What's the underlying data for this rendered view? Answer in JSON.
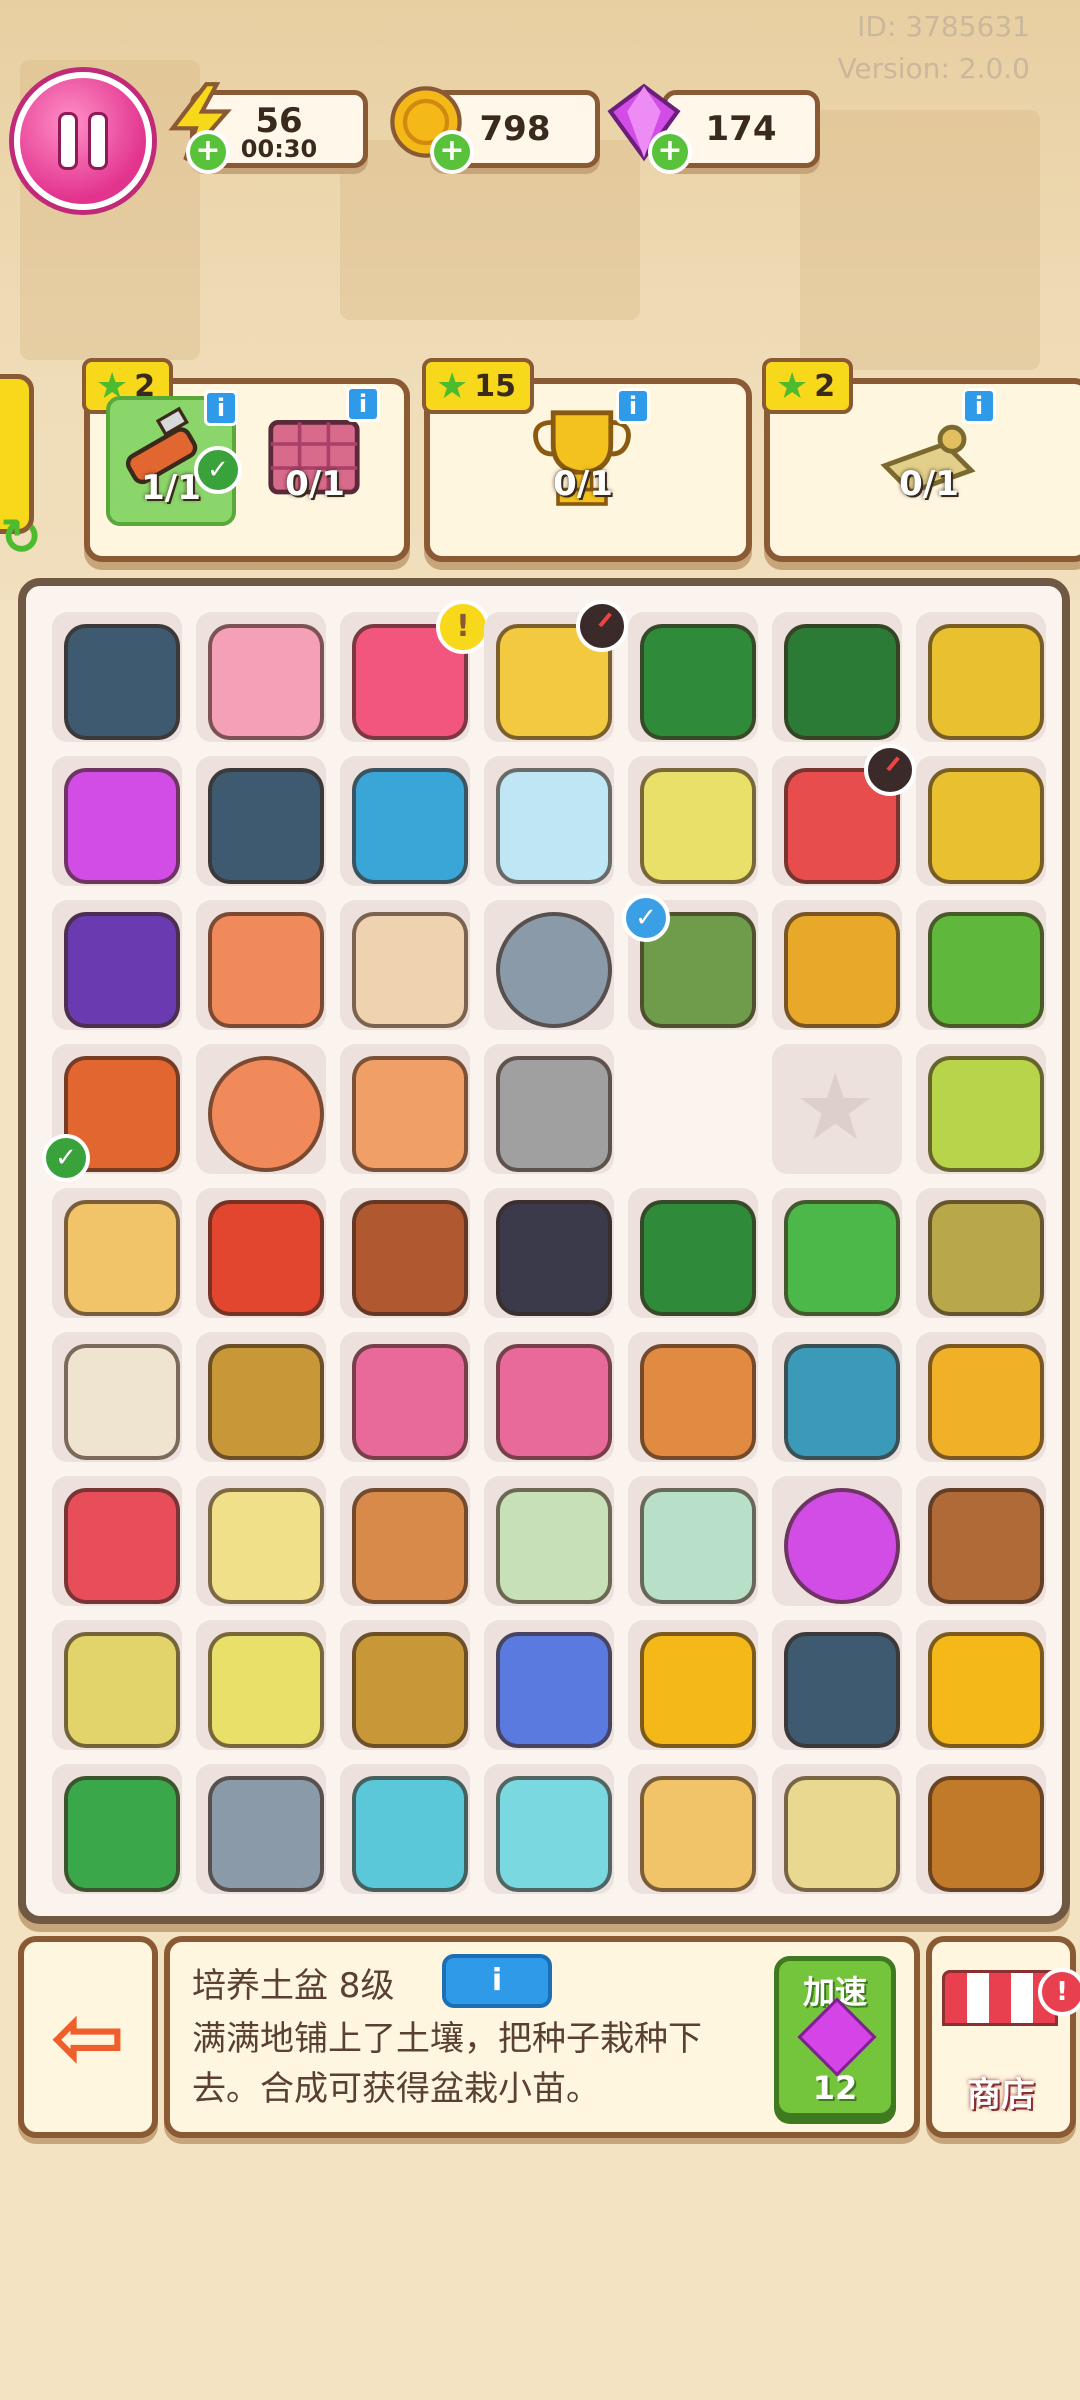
{
  "meta": {
    "id": "ID: 3785631",
    "version": "Version: 2.0.0"
  },
  "hud": {
    "energy": {
      "value": "56",
      "timer": "00:30"
    },
    "coins": {
      "value": "798"
    },
    "gems": {
      "value": "174"
    }
  },
  "orders": [
    {
      "stars": "2",
      "items": [
        {
          "icon": "box-cutter-icon",
          "count": "1/1",
          "done": true,
          "color": "#e2662f"
        },
        {
          "icon": "brick-pallet-icon",
          "count": "0/1",
          "done": false,
          "color": "#d86a8c"
        }
      ]
    },
    {
      "stars": "15",
      "items": [
        {
          "icon": "trophy-icon",
          "count": "0/1",
          "done": false,
          "color": "#f4c21e"
        }
      ]
    },
    {
      "stars": "2",
      "items": [
        {
          "icon": "scroll-icon",
          "count": "0/1",
          "done": false,
          "color": "#e2d08a"
        }
      ]
    }
  ],
  "board": [
    [
      {
        "icon": "cobweb-chip-icon",
        "color": "#3d5a70"
      },
      {
        "icon": "pink-handbag-icon",
        "color": "#f4a1b8"
      },
      {
        "icon": "pink-backpack-icon",
        "color": "#f2567f",
        "badge": "alert"
      },
      {
        "icon": "sprout-pot-icon",
        "color": "#f3c942",
        "badge": "clock"
      },
      {
        "icon": "green-toolbox-open-icon",
        "color": "#2f8a3a"
      },
      {
        "icon": "green-toolbox-icon",
        "color": "#2b7a35"
      },
      {
        "icon": "shopping-cart-full-icon",
        "color": "#e8c030"
      }
    ],
    [
      {
        "icon": "gem-icon",
        "color": "#d24ce6"
      },
      {
        "icon": "cobweb-chip-icon",
        "color": "#3d5a70"
      },
      {
        "icon": "robot-vacuum-blue-icon",
        "color": "#3aa6d8"
      },
      {
        "icon": "robot-vacuum-white-icon",
        "color": "#bfe6f4"
      },
      {
        "icon": "dumbbell-basket-icon",
        "color": "#e9e06a"
      },
      {
        "icon": "tool-bucket-icon",
        "color": "#e84d4d",
        "badge": "clock"
      },
      {
        "icon": "shopping-cart-icon",
        "color": "#e8c030"
      }
    ],
    [
      {
        "icon": "goggles-icon",
        "color": "#6a3ab0"
      },
      {
        "icon": "mallet-icon",
        "color": "#f08a5a"
      },
      {
        "icon": "tape-roll-icon",
        "color": "#efd2b0"
      },
      {
        "icon": "snail-shell-icon",
        "color": "#8a9aa8",
        "round": true
      },
      {
        "icon": "work-glove-icon",
        "color": "#6f9c4a",
        "badge": "check"
      },
      {
        "icon": "cardboard-box-icon",
        "color": "#e8a82a"
      },
      {
        "icon": "pipe-wrench-icon",
        "color": "#5fb83c"
      }
    ],
    [
      {
        "icon": "box-cutter-icon",
        "color": "#e2662f",
        "badge": "check-green"
      },
      {
        "icon": "tape-measure-icon",
        "color": "#f08a5a",
        "round": true
      },
      {
        "icon": "pencil-icon",
        "color": "#f0a066"
      },
      {
        "icon": "trowel-icon",
        "color": "#a0a0a0"
      },
      {
        "icon": "empty-cell-icon",
        "empty": true
      },
      {
        "icon": "locked-star-icon",
        "star": true
      },
      {
        "icon": "seed-bag-icon",
        "color": "#b8d44a"
      }
    ],
    [
      {
        "icon": "hamster-icon",
        "color": "#f1c46a"
      },
      {
        "icon": "keys-icon",
        "color": "#e2462f"
      },
      {
        "icon": "wallet-icon",
        "color": "#b0582f"
      },
      {
        "icon": "boxing-glove-icon",
        "color": "#3a3a4a"
      },
      {
        "icon": "green-case-icon",
        "color": "#2f8a3a"
      },
      {
        "icon": "adjustable-wrench-icon",
        "color": "#4db84a"
      },
      {
        "icon": "flat-seed-bag-icon",
        "color": "#b8a84a"
      }
    ],
    [
      {
        "icon": "sleeping-mouse-icon",
        "color": "#efe4cf"
      },
      {
        "icon": "wicker-basket-icon",
        "color": "#c89838"
      },
      {
        "icon": "bricks-icon",
        "color": "#e86a9a"
      },
      {
        "icon": "brick-icon",
        "color": "#e86a9a"
      },
      {
        "icon": "clay-pot-icon",
        "color": "#e08a42"
      },
      {
        "icon": "tile-stack-icon",
        "color": "#3a9ab8"
      },
      {
        "icon": "folder-icon",
        "color": "#f0b028"
      }
    ],
    [
      {
        "icon": "soil-basket-icon",
        "color": "#e84d5a"
      },
      {
        "icon": "frame-icon",
        "color": "#f1e08a"
      },
      {
        "icon": "clay-chunks-icon",
        "color": "#d88a4a"
      },
      {
        "icon": "magazine-icon",
        "color": "#c8e0b8"
      },
      {
        "icon": "photo-card-icon",
        "color": "#b8e0c8"
      },
      {
        "icon": "energy-orb-icon",
        "color": "#d24ce6",
        "round": true
      },
      {
        "icon": "potted-plant-icon",
        "color": "#b06a38"
      }
    ],
    [
      {
        "icon": "jump-rope-icon",
        "color": "#e2d46a"
      },
      {
        "icon": "dumbbell-basket-icon",
        "color": "#e9e06a"
      },
      {
        "icon": "woven-basket-icon",
        "color": "#c89838"
      },
      {
        "icon": "neck-pillow-icon",
        "color": "#5a7ae0"
      },
      {
        "icon": "coin-pile-icon",
        "color": "#f4b818"
      },
      {
        "icon": "cobweb-chip-icon",
        "color": "#3d5a70"
      },
      {
        "icon": "coin-stack-icon",
        "color": "#f4b818"
      }
    ],
    [
      {
        "icon": "megaphone-icon",
        "color": "#3aa84a"
      },
      {
        "icon": "chest-expander-icon",
        "color": "#8a9aa8"
      },
      {
        "icon": "ab-bench-icon",
        "color": "#5ac8d8"
      },
      {
        "icon": "hand-dumbbells-icon",
        "color": "#7ad8e0"
      },
      {
        "icon": "hamster-sitting-icon",
        "color": "#f1c46a"
      },
      {
        "icon": "snail-cat-icon",
        "color": "#e8d890"
      },
      {
        "icon": "guinea-pig-family-icon",
        "color": "#c07a2a"
      }
    ]
  ],
  "selected": {
    "title": "培养土盆 8级",
    "info_label": "i",
    "description": "满满地铺上了土壤，把种子栽种下去。合成可获得盆栽小苗。",
    "speedup_label": "加速",
    "speedup_cost": "12"
  },
  "shop": {
    "label": "商店"
  },
  "colors": {
    "board_border": "#6f5844",
    "panel_border": "#8a5a35",
    "accent_green": "#74c43c",
    "accent_pink": "#e2338d"
  }
}
